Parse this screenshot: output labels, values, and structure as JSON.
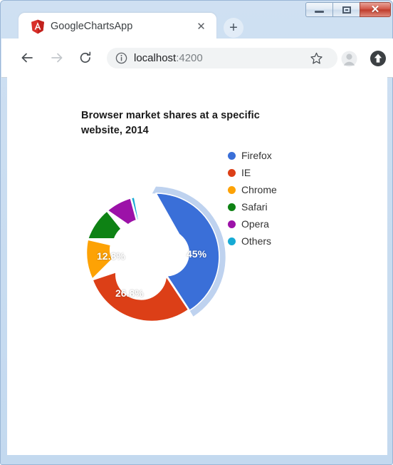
{
  "window": {
    "controls": {
      "minimize_label": "Minimize",
      "maximize_label": "Restore",
      "close_label": "✕"
    }
  },
  "browser": {
    "tab": {
      "title": "GoogleChartsApp",
      "favicon": "angular-logo-icon",
      "close_label": "✕"
    },
    "new_tab_label": "+",
    "toolbar": {
      "back_label": "Back",
      "forward_label": "Forward",
      "reload_label": "Reload",
      "bookmark_label": "Bookmark this page",
      "profile_label": "Profile",
      "update_label": "Update available"
    },
    "omnibox": {
      "host": "localhost",
      "port": ":4200",
      "full_url": "localhost:4200",
      "site_info_icon": "info-circle-icon"
    }
  },
  "chart_data": {
    "type": "pie",
    "variant": "donut",
    "title": "Browser market shares at a specific website, 2014",
    "categories": [
      "Firefox",
      "IE",
      "Chrome",
      "Safari",
      "Opera",
      "Others"
    ],
    "values": [
      45,
      26.8,
      12.8,
      8.5,
      6.2,
      0.7
    ],
    "data_labels": [
      "45%",
      "26.8%",
      "12.8%",
      "",
      "",
      ""
    ],
    "colors": [
      "#3a6fd8",
      "#dc3f17",
      "#fda205",
      "#0e8214",
      "#9c12a8",
      "#16aad4"
    ],
    "highlighted_slice": "Firefox",
    "highlight_color": "#bed2ef",
    "legend_position": "right",
    "legend_entries": [
      {
        "label": "Firefox",
        "color": "#3a6fd8"
      },
      {
        "label": "IE",
        "color": "#dc3f17"
      },
      {
        "label": "Chrome",
        "color": "#fda205"
      },
      {
        "label": "Safari",
        "color": "#0e8214"
      },
      {
        "label": "Opera",
        "color": "#9c12a8"
      },
      {
        "label": "Others",
        "color": "#16aad4"
      }
    ],
    "xlabel": "",
    "ylabel": "",
    "units": "percent"
  }
}
